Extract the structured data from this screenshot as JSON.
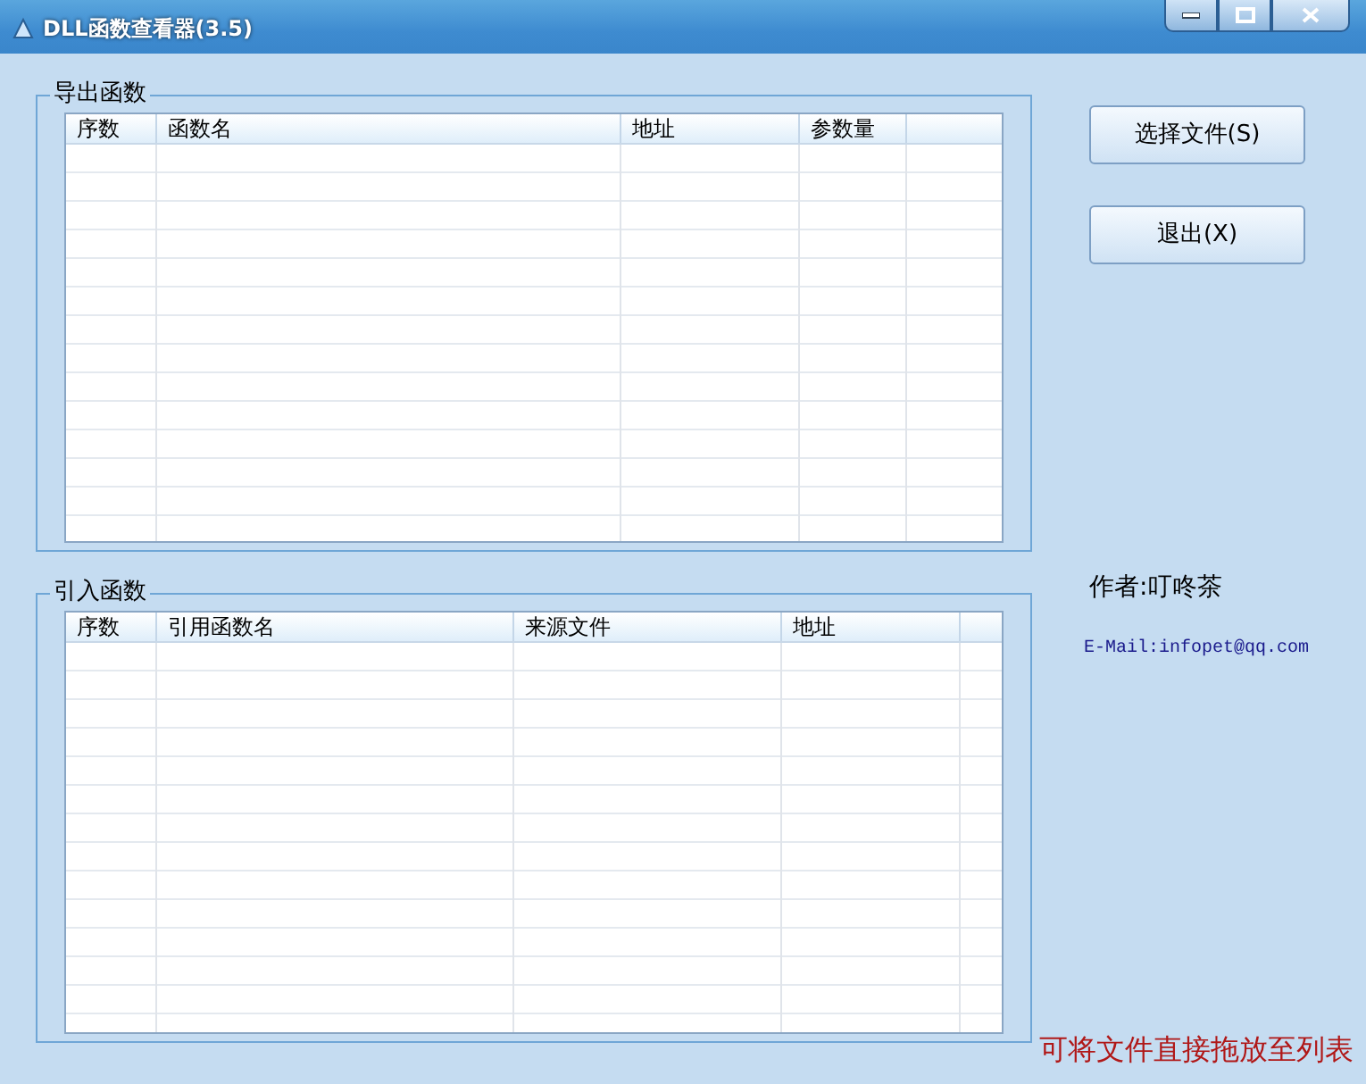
{
  "window": {
    "title": "DLL函数查看器(3.5)"
  },
  "export_group": {
    "title": "导出函数",
    "columns": [
      "序数",
      "函数名",
      "地址",
      "参数量"
    ]
  },
  "import_group": {
    "title": "引入函数",
    "columns": [
      "序数",
      "引用函数名",
      "来源文件",
      "地址"
    ]
  },
  "buttons": [
    {
      "label": "选择文件(S)"
    },
    {
      "label": "退出(X)"
    }
  ],
  "author": "作者:叮咚茶",
  "email": "E-Mail:infopet@qq.com",
  "hint": "可将文件直接拖放至列表"
}
